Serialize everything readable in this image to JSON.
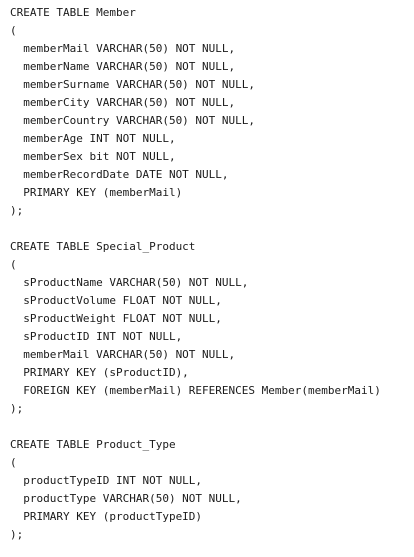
{
  "code": {
    "lines": [
      "CREATE TABLE Member",
      "(",
      "  memberMail VARCHAR(50) NOT NULL,",
      "  memberName VARCHAR(50) NOT NULL,",
      "  memberSurname VARCHAR(50) NOT NULL,",
      "  memberCity VARCHAR(50) NOT NULL,",
      "  memberCountry VARCHAR(50) NOT NULL,",
      "  memberAge INT NOT NULL,",
      "  memberSex bit NOT NULL,",
      "  memberRecordDate DATE NOT NULL,",
      "  PRIMARY KEY (memberMail)",
      ");",
      "",
      "CREATE TABLE Special_Product",
      "(",
      "  sProductName VARCHAR(50) NOT NULL,",
      "  sProductVolume FLOAT NOT NULL,",
      "  sProductWeight FLOAT NOT NULL,",
      "  sProductID INT NOT NULL,",
      "  memberMail VARCHAR(50) NOT NULL,",
      "  PRIMARY KEY (sProductID),",
      "  FOREIGN KEY (memberMail) REFERENCES Member(memberMail)",
      ");",
      "",
      "CREATE TABLE Product_Type",
      "(",
      "  productTypeID INT NOT NULL,",
      "  productType VARCHAR(50) NOT NULL,",
      "  PRIMARY KEY (productTypeID)",
      ");"
    ]
  }
}
